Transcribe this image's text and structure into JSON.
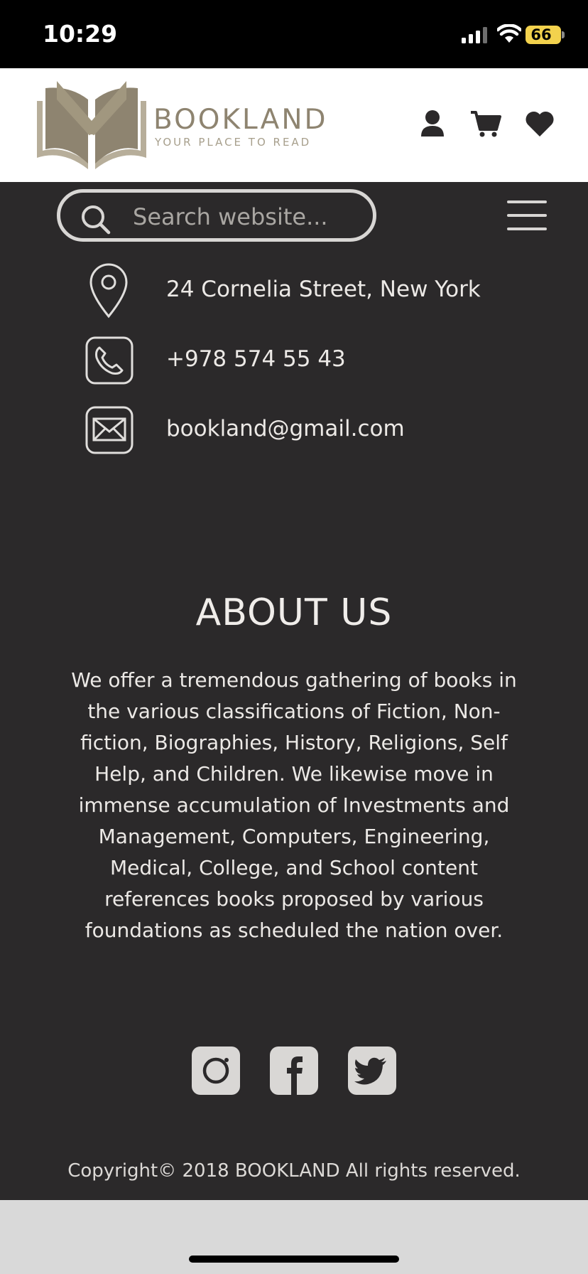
{
  "status_bar": {
    "time": "10:29",
    "battery": "66"
  },
  "header": {
    "logo_name": "BOOKLAND",
    "logo_tagline": "YOUR PLACE TO READ",
    "brand_color": "#8e8470"
  },
  "search": {
    "placeholder": "Search website..."
  },
  "contacts": {
    "address": "24 Cornelia Street, New York",
    "phone": "+978 574 55 43",
    "email": "bookland@gmail.com"
  },
  "about": {
    "title": "ABOUT US",
    "text": "We offer a tremendous gathering of books in the various classifications of Fiction, Non-fiction, Biographies, History, Religions, Self Help, and Children. We likewise move in immense accumulation of Investments and Management, Computers, Engineering, Medical, College, and School content references books proposed by various foundations as scheduled the nation over."
  },
  "social": {
    "icons": [
      "instagram-icon",
      "facebook-icon",
      "twitter-icon"
    ]
  },
  "footer": {
    "copyright": "Copyright© 2018 BOOKLAND All rights reserved."
  },
  "colors": {
    "background": "#2b292a",
    "header_background": "#ffffff",
    "battery": "#f3d24d"
  }
}
